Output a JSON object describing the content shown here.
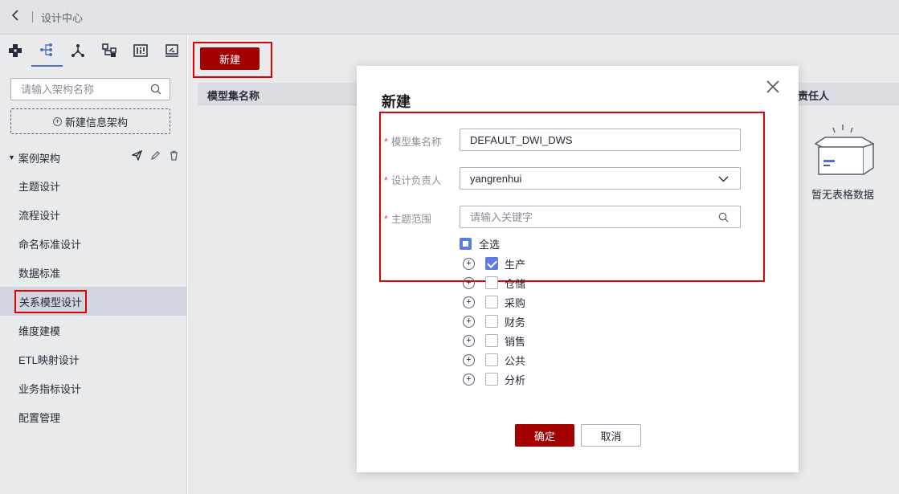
{
  "topbar": {
    "back_icon": "chevron-left-icon",
    "breadcrumb": "设计中心"
  },
  "sidebar": {
    "icons": [
      "grid-network-icon",
      "tree-branch-icon",
      "hierarchy-icon",
      "flow-node-icon",
      "metric-board-icon",
      "monitor-icon"
    ],
    "search_placeholder": "请输入架构名称",
    "new_arch_label": "新建信息架构",
    "tree_root": "案例架构",
    "nav_items": [
      {
        "label": "主题设计"
      },
      {
        "label": "流程设计"
      },
      {
        "label": "命名标准设计"
      },
      {
        "label": "数据标准"
      },
      {
        "label": "关系模型设计"
      },
      {
        "label": "维度建模"
      },
      {
        "label": "ETL映射设计"
      },
      {
        "label": "业务指标设计"
      },
      {
        "label": "配置管理"
      }
    ]
  },
  "main": {
    "new_button": "新建",
    "columns": [
      "模型集名称",
      "责任人"
    ],
    "empty_text": "暂无表格数据"
  },
  "dialog": {
    "title": "新建",
    "fields": {
      "model_set_name": {
        "label": "模型集名称",
        "value": "DEFAULT_DWI_DWS"
      },
      "design_owner": {
        "label": "设计负责人",
        "value": "yangrenhui"
      },
      "subject_scope": {
        "label": "主题范围",
        "placeholder": "请输入关键字"
      }
    },
    "select_all": "全选",
    "subjects": [
      {
        "label": "生产",
        "checked": true
      },
      {
        "label": "仓储",
        "checked": false
      },
      {
        "label": "采购",
        "checked": false
      },
      {
        "label": "财务",
        "checked": false
      },
      {
        "label": "销售",
        "checked": false
      },
      {
        "label": "公共",
        "checked": false
      },
      {
        "label": "分析",
        "checked": false
      }
    ],
    "ok_label": "确定",
    "cancel_label": "取消"
  },
  "colors": {
    "primary": "#a30000",
    "highlight": "#e00000",
    "accent": "#5e7ce0"
  }
}
